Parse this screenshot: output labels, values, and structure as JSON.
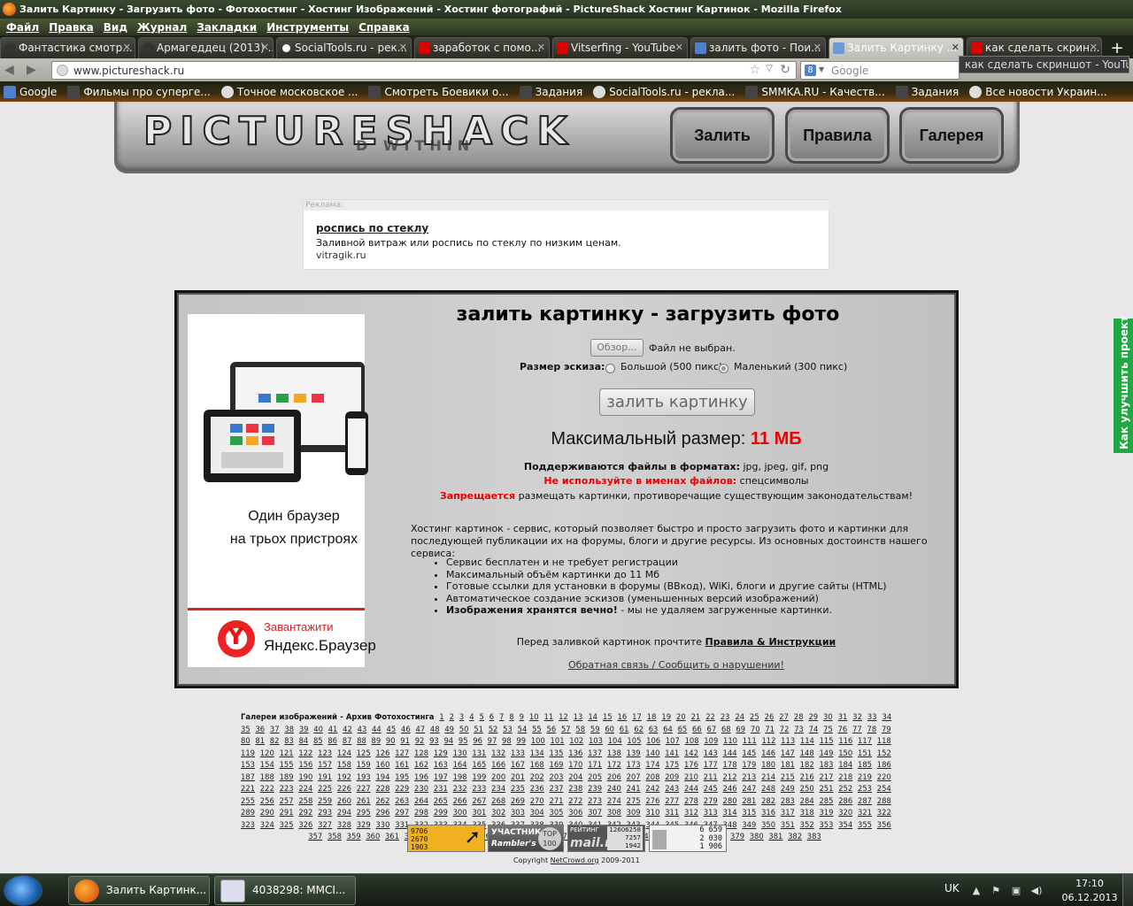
{
  "window": {
    "title": "Залить Картинку - Загрузить фото - Фотохостинг - Хостинг Изображений - Хостинг фотографий - PictureShack Хостинг Картинок - Mozilla Firefox"
  },
  "menu": [
    "Файл",
    "Правка",
    "Вид",
    "Журнал",
    "Закладки",
    "Инструменты",
    "Справка"
  ],
  "tabs": [
    {
      "label": "Фантастика смотр...",
      "icon": "smiley-icon"
    },
    {
      "label": "Армагеддец (2013) ...",
      "icon": "smiley-icon"
    },
    {
      "label": "SocialTools.ru - рек...",
      "icon": "dot-icon"
    },
    {
      "label": "заработок с помо...",
      "icon": "youtube-icon"
    },
    {
      "label": "Vitserfing - YouTube",
      "icon": "youtube-icon"
    },
    {
      "label": "залить фото - Пои...",
      "icon": "google-icon"
    },
    {
      "label": "Залить Картинку ...",
      "icon": "picture-icon",
      "active": true
    },
    {
      "label": "как сделать скрин...",
      "icon": "youtube-icon"
    }
  ],
  "nav": {
    "url": "www.pictureshack.ru",
    "search_engine": "8",
    "search_placeholder": "Google",
    "tooltip": "как сделать скриншот - YouTube"
  },
  "bookmarks": [
    {
      "label": "Google",
      "icon": "google-icon"
    },
    {
      "label": "Фильмы про суперге...",
      "icon": "smiley-icon"
    },
    {
      "label": "Точное московское ...",
      "icon": "clock-icon"
    },
    {
      "label": "Смотреть Боевики о...",
      "icon": "smiley-icon"
    },
    {
      "label": "Задания",
      "icon": "hand-icon"
    },
    {
      "label": "SocialTools.ru - рекла...",
      "icon": "dot-icon"
    },
    {
      "label": "SMMKA.RU - Качеств...",
      "icon": "s-icon"
    },
    {
      "label": "Задания",
      "icon": "tank-icon"
    },
    {
      "label": "Все новости Украин...",
      "icon": "ua-icon"
    }
  ],
  "site": {
    "logo": "PICTURESHACK",
    "logo_sub": "D WITHIN",
    "nav": [
      "Залить",
      "Правила",
      "Галерея"
    ]
  },
  "ad": {
    "label": "Реклама:",
    "title": "роспись по стеклу",
    "desc": "Заливной витраж или роспись по стеклу по низким ценам.",
    "site": "vitragik.ru"
  },
  "banner": {
    "slogan_line1": "Один браузер",
    "slogan_line2": "на трьох пристроях",
    "cta": "Завантажити",
    "brand": "Яндекс.Браузер"
  },
  "upload": {
    "title": "залить картинку - загрузить фото",
    "browse": "Обзор...",
    "no_file": "Файл не выбран.",
    "size_label": "Размер эскиза:",
    "size_large": "Большой (500 пикс)",
    "size_small": "Маленький (300 пикс)",
    "selected_size": "small",
    "button": "залить картинку",
    "max_prefix": "Максимальный размер:",
    "max_value": "11 МБ",
    "formats_label": "Поддерживаются файлы в форматах:",
    "formats": "jpg, jpeg, gif, png",
    "warn_label": "Не используйте в именах файлов:",
    "warn_value": "спецсимволы",
    "forbid_label": "Запрещается",
    "forbid_text": "размещать картинки, противоречащие существующим законодательствам!",
    "description": "Хостинг картинок - сервис, который позволяет быстро и просто загрузить фото и картинки для последующей публикации их на форумы, блоги и другие ресурсы. Из основных достоинств нашего сервиса:",
    "features": [
      "Сервис бесплатен и не требует регистрации",
      "Максимальный объём картинки до 11 Мб",
      "Готовые ссылки для установки в форумы (ВВкод), WiKi, блоги и другие сайты (HTML)",
      "Автоматическое создание эскизов (уменьшенных версий изображений)"
    ],
    "feature_last_bold": "Изображения хранятся вечно!",
    "feature_last_rest": " - мы не удаляем загруженные картинки.",
    "read_before": "Перед заливкой картинок прочтите",
    "rules_link": "Правила & Инструкции",
    "feedback": "Обратная связь / Сообщить о нарушении!"
  },
  "gallery": {
    "label": "Галереи изображений - Архив Фотохостинга",
    "first_page": 1,
    "last_page": 383
  },
  "counters": {
    "c1": [
      "9706",
      "2670",
      "1903"
    ],
    "c2_title": "УЧАСТНИК",
    "c2_brand": "Rambler's",
    "c2_top": "TOP 100",
    "c3_label": "РЕЙТИНГ",
    "c3_brand": "mail.ru",
    "c3_nums": [
      "12606258",
      "7257",
      "1942"
    ],
    "c4_nums": [
      "6 659",
      "2 030",
      "1 906"
    ]
  },
  "copyright": {
    "prefix": "Copyright",
    "link": "NetCrowd.org",
    "years": "2009-2011"
  },
  "side_feedback": "Как улучшить проект",
  "taskbar": {
    "items": [
      {
        "label": "Залить Картинк..."
      },
      {
        "label": "4038298: MMCI..."
      }
    ],
    "lang": "UK",
    "time": "17:10",
    "date": "06.12.2013"
  }
}
